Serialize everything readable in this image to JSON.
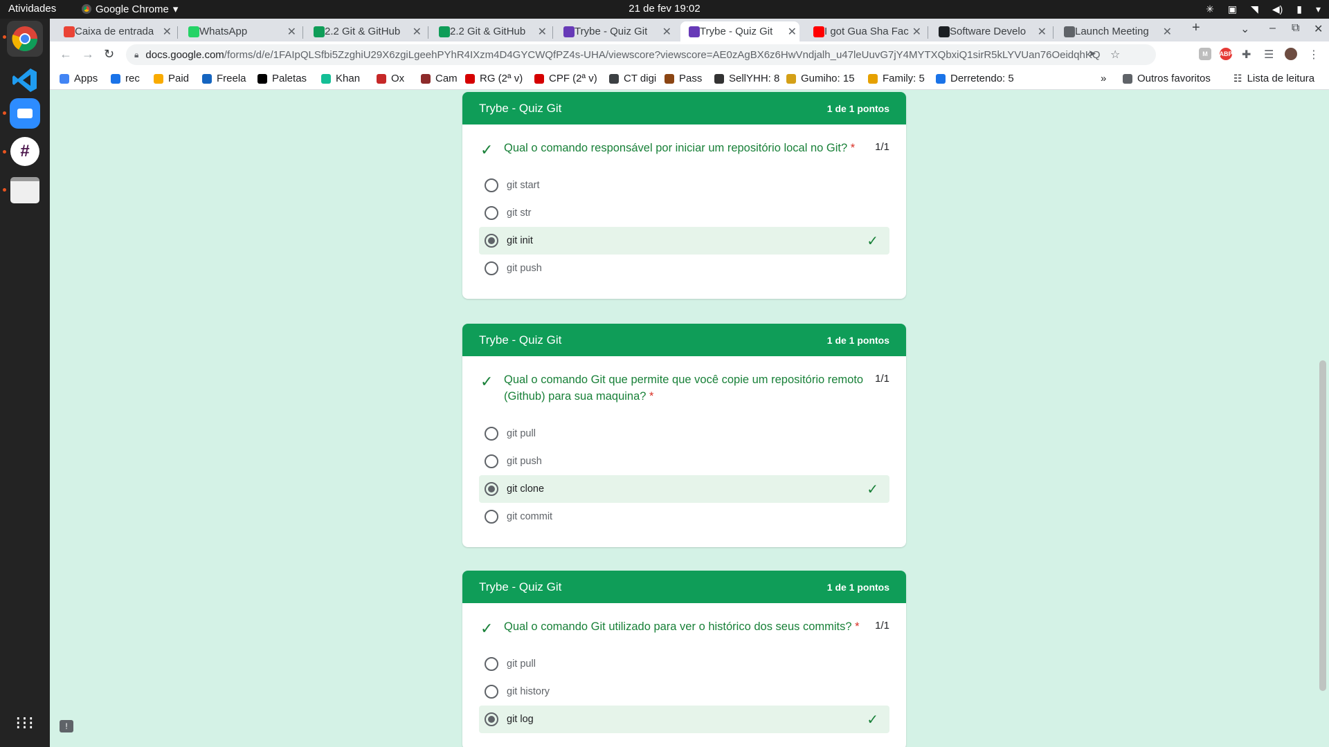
{
  "system": {
    "activities": "Atividades",
    "app_name": "Google Chrome",
    "clock": "21 de fev  19:02"
  },
  "browser": {
    "tabs": [
      {
        "label": "Caixa de entrada",
        "icon": "gmail-icon",
        "color": "#ea4335"
      },
      {
        "label": "WhatsApp",
        "icon": "whatsapp-icon",
        "color": "#25d366"
      },
      {
        "label": "2.2 Git & GitHub",
        "icon": "trybe-icon",
        "color": "#0f9d58"
      },
      {
        "label": "2.2 Git & GitHub",
        "icon": "trybe-icon",
        "color": "#0f9d58"
      },
      {
        "label": "Trybe - Quiz Git",
        "icon": "forms-icon",
        "color": "#673ab7"
      },
      {
        "label": "Trybe - Quiz Git",
        "icon": "forms-icon",
        "color": "#673ab7"
      },
      {
        "label": "I got Gua Sha Fac",
        "icon": "youtube-icon",
        "color": "#ff0000"
      },
      {
        "label": "Software Develo",
        "icon": "github-icon",
        "color": "#1b1f23"
      },
      {
        "label": "Launch Meeting",
        "icon": "globe-icon",
        "color": "#5f6368"
      }
    ],
    "url_host": "docs.google.com",
    "url_path": "/forms/d/e/1FAIpQLSfbi5ZzghiU29X6zgiLgeehPYhR4IXzm4D4GYCWQfPZ4s-UHA/viewscore?viewscore=AE0zAgBX6z6HwVndjalh_u47leUuvG7jY4MYTXQbxiQ1sirR5kLYVUan76OeidqhKQ",
    "bookmarks": [
      {
        "label": "Apps",
        "color": "#4285f4"
      },
      {
        "label": "rec",
        "color": "#1a73e8"
      },
      {
        "label": "Paid",
        "color": "#f9ab00"
      },
      {
        "label": "Freela",
        "color": "#1565c0"
      },
      {
        "label": "Paletas",
        "color": "#000000"
      },
      {
        "label": "Khan",
        "color": "#14bf96"
      },
      {
        "label": "Ox",
        "color": "#c62828"
      },
      {
        "label": "Cam",
        "color": "#8d2b2b"
      },
      {
        "label": "RG (2ª v)",
        "color": "#d50000"
      },
      {
        "label": "CPF (2ª v)",
        "color": "#d50000"
      },
      {
        "label": "CT digi",
        "color": "#3c4043"
      },
      {
        "label": "Pass",
        "color": "#8b4513"
      },
      {
        "label": "SellYHH: 8",
        "color": "#333333"
      },
      {
        "label": "Gumiho: 15",
        "color": "#d4a017"
      },
      {
        "label": "Family: 5",
        "color": "#e6a100"
      },
      {
        "label": "Derretendo: 5",
        "color": "#1a73e8"
      }
    ],
    "bookmarks_overflow": "»",
    "other_bookmarks": "Outros favoritos",
    "reading_list": "Lista de leitura"
  },
  "quiz": {
    "cards": [
      {
        "title": "Trybe - Quiz Git",
        "points": "1 de 1 pontos",
        "question": "Qual o comando responsável por iniciar um repositório local no Git?",
        "required_mark": "*",
        "score": "1/1",
        "options": [
          {
            "label": "git start",
            "selected": false
          },
          {
            "label": "git str",
            "selected": false
          },
          {
            "label": "git init",
            "selected": true
          },
          {
            "label": "git push",
            "selected": false
          }
        ]
      },
      {
        "title": "Trybe - Quiz Git",
        "points": "1 de 1 pontos",
        "question": "Qual o comando Git que permite que você copie um repositório remoto (Github) para sua maquina?",
        "required_mark": "*",
        "score": "1/1",
        "options": [
          {
            "label": "git pull",
            "selected": false
          },
          {
            "label": "git push",
            "selected": false
          },
          {
            "label": "git clone",
            "selected": true
          },
          {
            "label": "git commit",
            "selected": false
          }
        ]
      },
      {
        "title": "Trybe - Quiz Git",
        "points": "1 de 1 pontos",
        "question": "Qual o comando Git utilizado para ver o histórico dos seus commits?",
        "required_mark": "*",
        "score": "1/1",
        "options": [
          {
            "label": "git pull",
            "selected": false
          },
          {
            "label": "git history",
            "selected": false
          },
          {
            "label": "git log",
            "selected": true
          }
        ]
      }
    ]
  },
  "colors": {
    "form_header": "#0f9d58",
    "correct_text": "#188038",
    "correct_bg": "#e6f4ea",
    "page_bg": "#d4f2e6"
  }
}
